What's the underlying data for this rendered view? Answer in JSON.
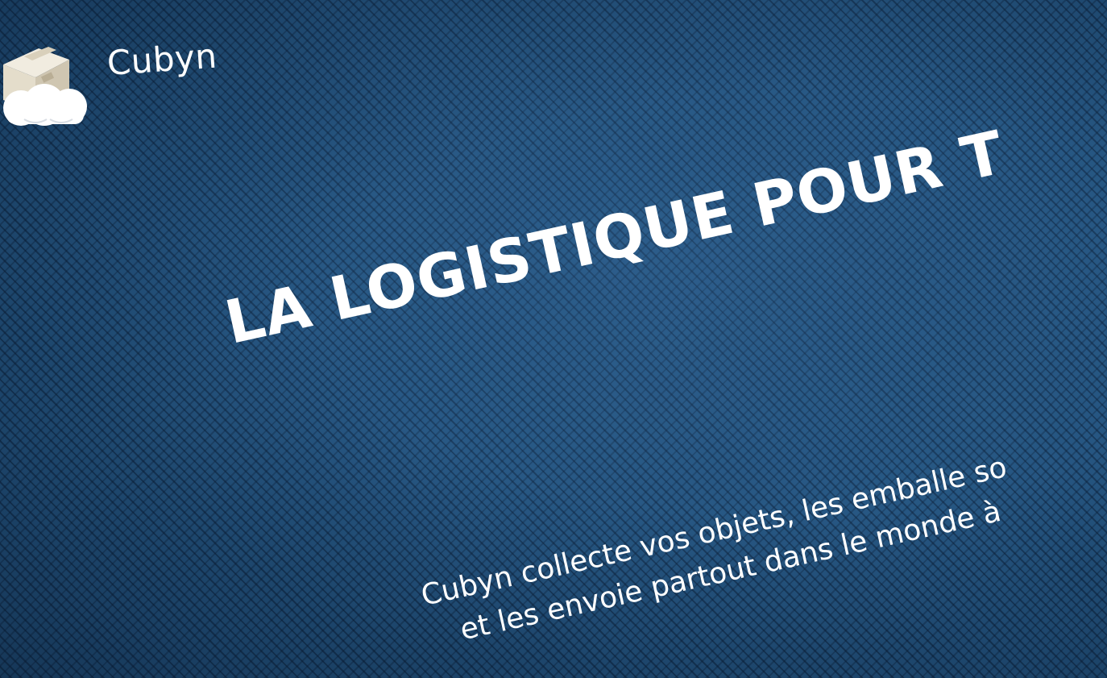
{
  "header": {
    "logo_text": "Cubyn",
    "logo_icon": "box-on-cloud-icon"
  },
  "hero": {
    "title": "LA LOGISTIQUE POUR T",
    "description_line1": "Cubyn collecte vos objets, les emballe so",
    "description_line2": "et les envoie partout dans le monde à"
  },
  "colors": {
    "background": "#24547f",
    "pattern": "#0f2a45",
    "text": "#ffffff",
    "cloud": "#ffffff",
    "box": "#e8e2d2"
  }
}
